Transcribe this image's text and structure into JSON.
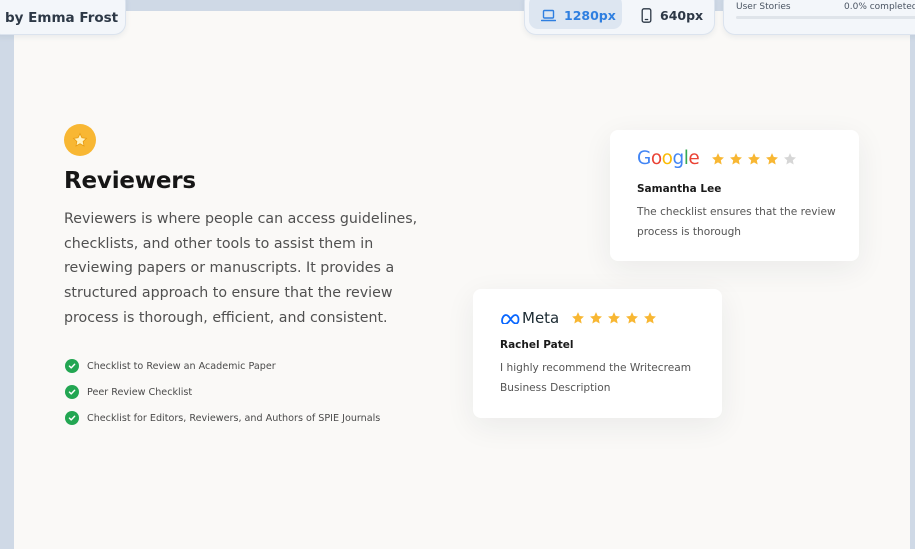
{
  "toolbar": {
    "author": "by Emma Frost",
    "devices": [
      {
        "label": "1280px",
        "icon": "laptop-icon",
        "active": true
      },
      {
        "label": "640px",
        "icon": "mobile-icon",
        "active": false
      }
    ],
    "progress": {
      "label": "User Stories",
      "percent_text": "0.0% completed",
      "value": 0.0
    }
  },
  "section": {
    "badge_icon": "star-icon",
    "title": "Reviewers",
    "description": "Reviewers is where people can access guidelines, checklists, and other tools to assist them in reviewing papers or manuscripts. It provides a structured approach to ensure that the review process is thorough, efficient, and consistent.",
    "checklist": [
      "Checklist to Review an Academic Paper",
      "Peer Review Checklist",
      "Checklist for Editors, Reviewers, and Authors of SPIE Journals"
    ]
  },
  "reviews": [
    {
      "brand": "Google",
      "rating": 4,
      "max_rating": 5,
      "name": "Samantha Lee",
      "text": "The checklist ensures that the review process is thorough"
    },
    {
      "brand": "Meta",
      "rating": 5,
      "max_rating": 5,
      "name": "Rachel Patel",
      "text": "I highly recommend the Writecream Business Description"
    }
  ],
  "colors": {
    "accent": "#2f7fe0",
    "star": "#f8b733",
    "star_empty": "#d6d6d6",
    "check": "#22a652",
    "google_blue": "#4285F4",
    "google_red": "#EA4335",
    "google_yellow": "#FBBC05",
    "google_green": "#34A853",
    "meta_blue": "#0866FF"
  }
}
